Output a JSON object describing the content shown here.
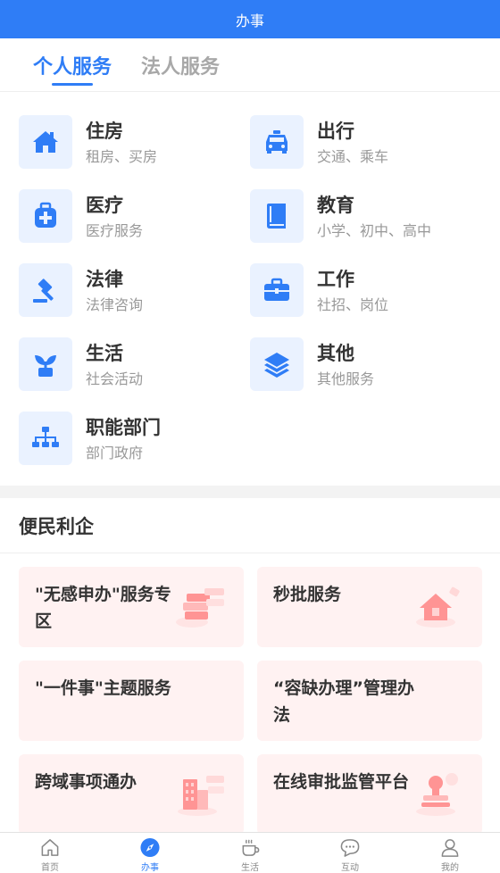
{
  "header": {
    "title": "办事"
  },
  "tabs": [
    {
      "label": "个人服务",
      "active": true
    },
    {
      "label": "法人服务",
      "active": false
    }
  ],
  "services": [
    {
      "title": "住房",
      "subtitle": "租房、买房",
      "icon": "house-icon"
    },
    {
      "title": "出行",
      "subtitle": "交通、乘车",
      "icon": "car-icon"
    },
    {
      "title": "医疗",
      "subtitle": "医疗服务",
      "icon": "medical-kit-icon"
    },
    {
      "title": "教育",
      "subtitle": "小学、初中、高中",
      "icon": "book-icon"
    },
    {
      "title": "法律",
      "subtitle": "法律咨询",
      "icon": "gavel-icon"
    },
    {
      "title": "工作",
      "subtitle": "社招、岗位",
      "icon": "briefcase-icon"
    },
    {
      "title": "生活",
      "subtitle": "社会活动",
      "icon": "plant-icon"
    },
    {
      "title": "其他",
      "subtitle": "其他服务",
      "icon": "layers-icon"
    },
    {
      "title": "职能部门",
      "subtitle": "部门政府",
      "icon": "org-chart-icon"
    }
  ],
  "convenience": {
    "title": "便民利企",
    "cards": [
      {
        "title": "\"无感申办\"服务专区",
        "illustration": "books-illustration"
      },
      {
        "title": "秒批服务",
        "illustration": "house-illustration"
      },
      {
        "title": "\"一件事\"主题服务",
        "illustration": ""
      },
      {
        "title": "“容缺办理”管理办法",
        "illustration": ""
      },
      {
        "title": "跨域事项通办",
        "illustration": "buildings-illustration"
      },
      {
        "title": "在线审批监管平台",
        "illustration": "stamp-illustration"
      }
    ]
  },
  "bottom_nav": [
    {
      "label": "首页",
      "icon": "home-nav-icon",
      "active": false
    },
    {
      "label": "办事",
      "icon": "compass-nav-icon",
      "active": true
    },
    {
      "label": "生活",
      "icon": "coffee-nav-icon",
      "active": false
    },
    {
      "label": "互动",
      "icon": "chat-nav-icon",
      "active": false
    },
    {
      "label": "我的",
      "icon": "user-nav-icon",
      "active": false
    }
  ],
  "colors": {
    "primary": "#2f7df6",
    "icon_bg": "#eaf2ff",
    "card_bg": "#fff2f2"
  }
}
